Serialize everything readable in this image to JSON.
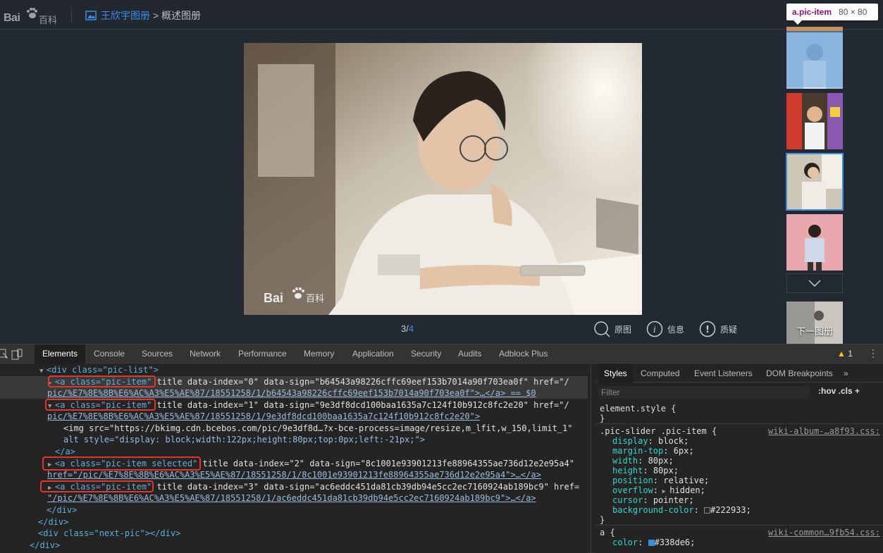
{
  "header": {
    "logo_text_left": "Bai",
    "logo_text_right": "百科",
    "album_link": "王欣宇图册",
    "separator": ">",
    "album_current": "概述图册"
  },
  "viewer": {
    "counter_current": "3/",
    "counter_total": "4",
    "tools": [
      "原图",
      "信息",
      "质疑"
    ],
    "watermark_left": "Bai",
    "watermark_right": "百科",
    "next_album": "下一图册",
    "tooltip_tag": "a.pic-item",
    "tooltip_dims": "80 × 80"
  },
  "devtools": {
    "tabs": [
      "Elements",
      "Console",
      "Sources",
      "Network",
      "Performance",
      "Memory",
      "Application",
      "Security",
      "Audits",
      "Adblock Plus"
    ],
    "warning_count": "1",
    "elements": {
      "l1_tag": "<div class=\"pic-list\">",
      "l2a": "<a class=\"pic-item\"",
      "l2b": " title data-index=\"0\" data-sign=\"b64543a98226cffc69eef153b7014a90f703ea0f\" href=\"/",
      "l3": "pic/%E7%8E%8B%E6%AC%A3%E5%AE%87/18551258/1/b64543a98226cffc69eef153b7014a90f703ea0f\">…</a> == $0",
      "l4a": "<a class=\"pic-item\"",
      "l4b": " title data-index=\"1\" data-sign=\"9e3df8dcd100baa1635a7c124f10b912c8fc2e20\" href=\"/",
      "l5": "pic/%E7%8E%8B%E6%AC%A3%E5%AE%87/18551258/1/9e3df8dcd100baa1635a7c124f10b912c8fc2e20\">",
      "l6": "<img src=\"https://bkimg.cdn.bcebos.com/pic/9e3df8d…?x-bce-process=image/resize,m_lfit,w_150,limit_1\"",
      "l7": "alt style=\"display: block;width:122px;height:80px;top:0px;left:-21px;\">",
      "l8": "</a>",
      "l9a": "<a class=\"pic-item selected\"",
      "l9b": " title data-index=\"2\" data-sign=\"8c1001e93901213fe88964355ae736d12e2e95a4\"",
      "l10": "href=\"/pic/%E7%8E%8B%E6%AC%A3%E5%AE%87/18551258/1/8c1001e93901213fe88964355ae736d12e2e95a4\">…</a>",
      "l11a": "<a class=\"pic-item\"",
      "l11b": " title data-index=\"3\" data-sign=\"ac6eddc451da81cb39db94e5cc2ec7160924ab189bc9\" href=",
      "l12": "\"/pic/%E7%8E%8B%E6%AC%A3%E5%AE%87/18551258/1/ac6eddc451da81cb39db94e5cc2ec7160924ab189bc9\">…</a>",
      "l13": "</div>",
      "l14": "</div>",
      "l15": "<div class=\"next-pic\"></div>",
      "l16": "</div>"
    },
    "styles": {
      "tabs": [
        "Styles",
        "Computed",
        "Event Listeners",
        "DOM Breakpoints",
        "»"
      ],
      "filter_placeholder": "Filter",
      "hov": ":hov .cls +",
      "element_style": "element.style {",
      "close": "}",
      "rule1_selector": ".pic-slider .pic-item {",
      "rule1_source": "wiki-album-…a8f93.css:",
      "rule1_props": [
        {
          "name": "display",
          "value": "block;"
        },
        {
          "name": "margin-top",
          "value": "6px;"
        },
        {
          "name": "width",
          "value": "80px;"
        },
        {
          "name": "height",
          "value": "80px;"
        },
        {
          "name": "position",
          "value": "relative;"
        },
        {
          "name": "overflow",
          "value": "hidden;"
        },
        {
          "name": "cursor",
          "value": "pointer;"
        },
        {
          "name": "background-color",
          "value": "#222933;"
        }
      ],
      "rule2_selector": "a {",
      "rule2_source": "wiki-common…9fb54.css:",
      "rule2_prop_name": "color",
      "rule2_prop_value": "#338de6;"
    },
    "colors": {
      "swatch1": "#222933",
      "swatch2": "#338de6"
    }
  }
}
